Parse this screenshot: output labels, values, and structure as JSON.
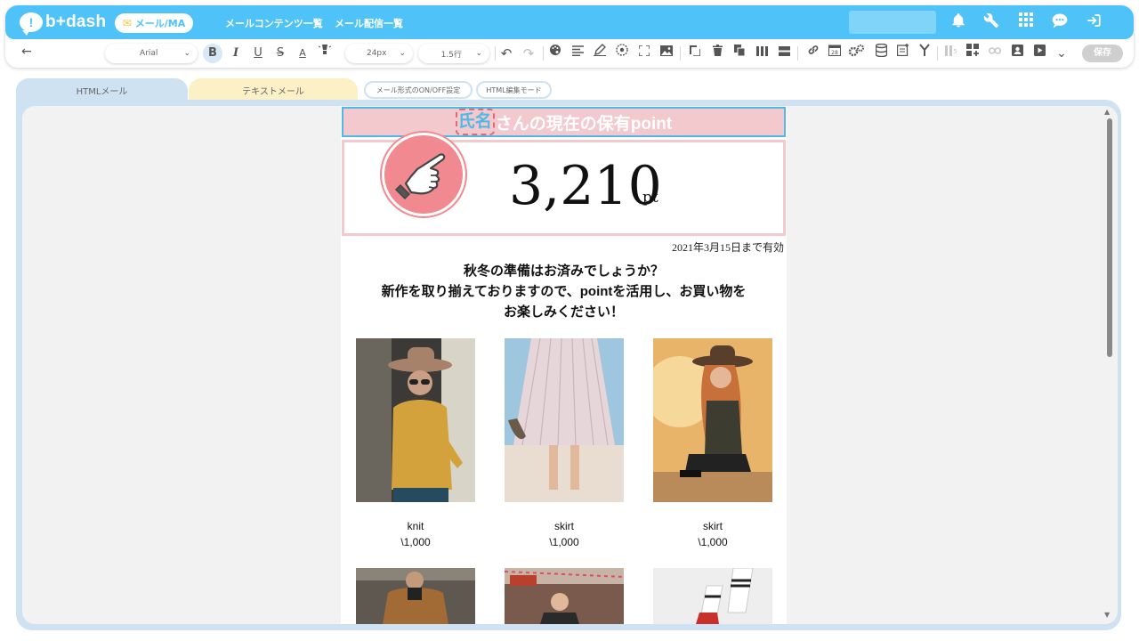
{
  "header": {
    "logo_text": "b+dash",
    "mode_pill": "メール/MA",
    "nav_contents": "メールコンテンツ一覧",
    "nav_delivery": "メール配信一覧"
  },
  "toolbar": {
    "font_family": "Arial",
    "font_size": "24px",
    "line_height": "1.5行",
    "bold": "B",
    "italic": "I",
    "underline": "U",
    "strike": "S",
    "font_color": "A",
    "save_label": "保存"
  },
  "tabs": {
    "html_mail": "HTMLメール",
    "text_mail": "テキストメール",
    "format_toggle": "メール形式のON/OFF設定",
    "html_mode": "HTML編集モード"
  },
  "mail": {
    "name_tag": "氏名",
    "title_rest": "さんの現在の保有point",
    "point_value": "3,210",
    "point_unit": "pt",
    "expiry": "2021年3月15日まで有効",
    "message_line1": "秋冬の準備はお済みでしょうか？",
    "message_line2": "新作を取り揃えておりますので、pointを活用し、お買い物を",
    "message_line3": "お楽しみください！",
    "products": [
      {
        "name": "knit",
        "price": "\\1,000"
      },
      {
        "name": "skirt",
        "price": "\\1,000"
      },
      {
        "name": "skirt",
        "price": "\\1,000"
      }
    ]
  },
  "colors": {
    "brand": "#4fc3f7",
    "title_bar": "#f3c9ce",
    "accent_pink": "#f08a90"
  }
}
